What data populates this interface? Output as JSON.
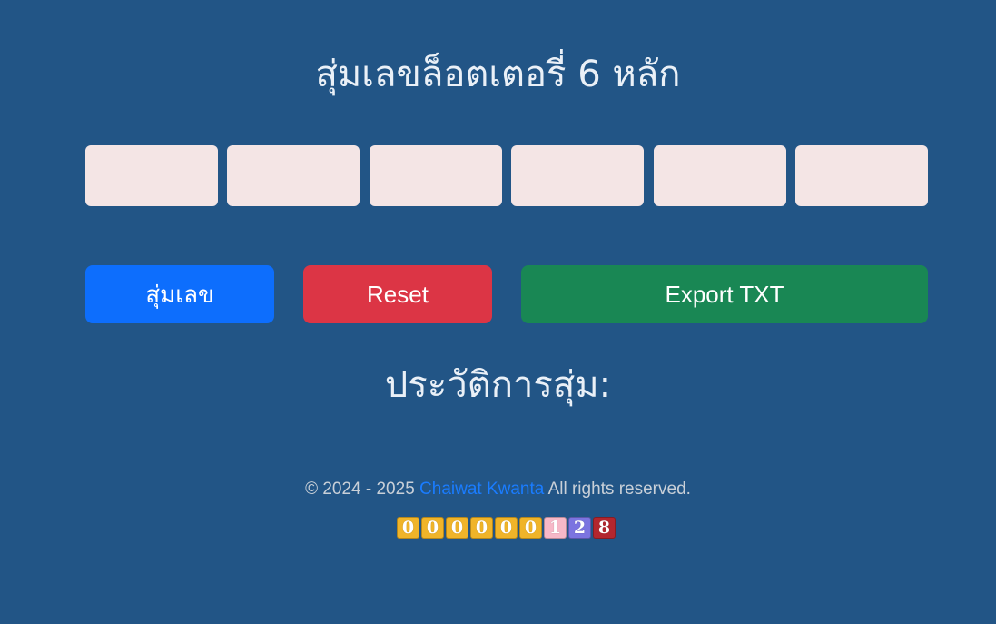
{
  "header": {
    "title": "สุ่มเลขล็อตเตอรี่ 6 หลัก"
  },
  "digits": [
    "",
    "",
    "",
    "",
    "",
    ""
  ],
  "buttons": {
    "random_label": "สุ่มเลข",
    "reset_label": "Reset",
    "export_label": "Export TXT"
  },
  "history": {
    "title": "ประวัติการสุ่ม:"
  },
  "footer": {
    "copyright_prefix": "© 2024 - 2025",
    "author_link": "Chaiwat Kwanta",
    "rights_suffix": "All rights reserved."
  },
  "counter": {
    "digits": [
      {
        "value": "0",
        "color": "#f0b429"
      },
      {
        "value": "0",
        "color": "#f0b429"
      },
      {
        "value": "0",
        "color": "#f0b429"
      },
      {
        "value": "0",
        "color": "#f0b429"
      },
      {
        "value": "0",
        "color": "#f0b429"
      },
      {
        "value": "0",
        "color": "#f0b429"
      },
      {
        "value": "1",
        "color": "#f7b8c8"
      },
      {
        "value": "2",
        "color": "#7b74e0"
      },
      {
        "value": "8",
        "color": "#b3262e"
      }
    ]
  },
  "colors": {
    "background": "#225586",
    "random_button": "#0d6efd",
    "reset_button": "#dc3545",
    "export_button": "#198754",
    "digit_box": "#f4e5e5",
    "link": "#1a7cff"
  }
}
